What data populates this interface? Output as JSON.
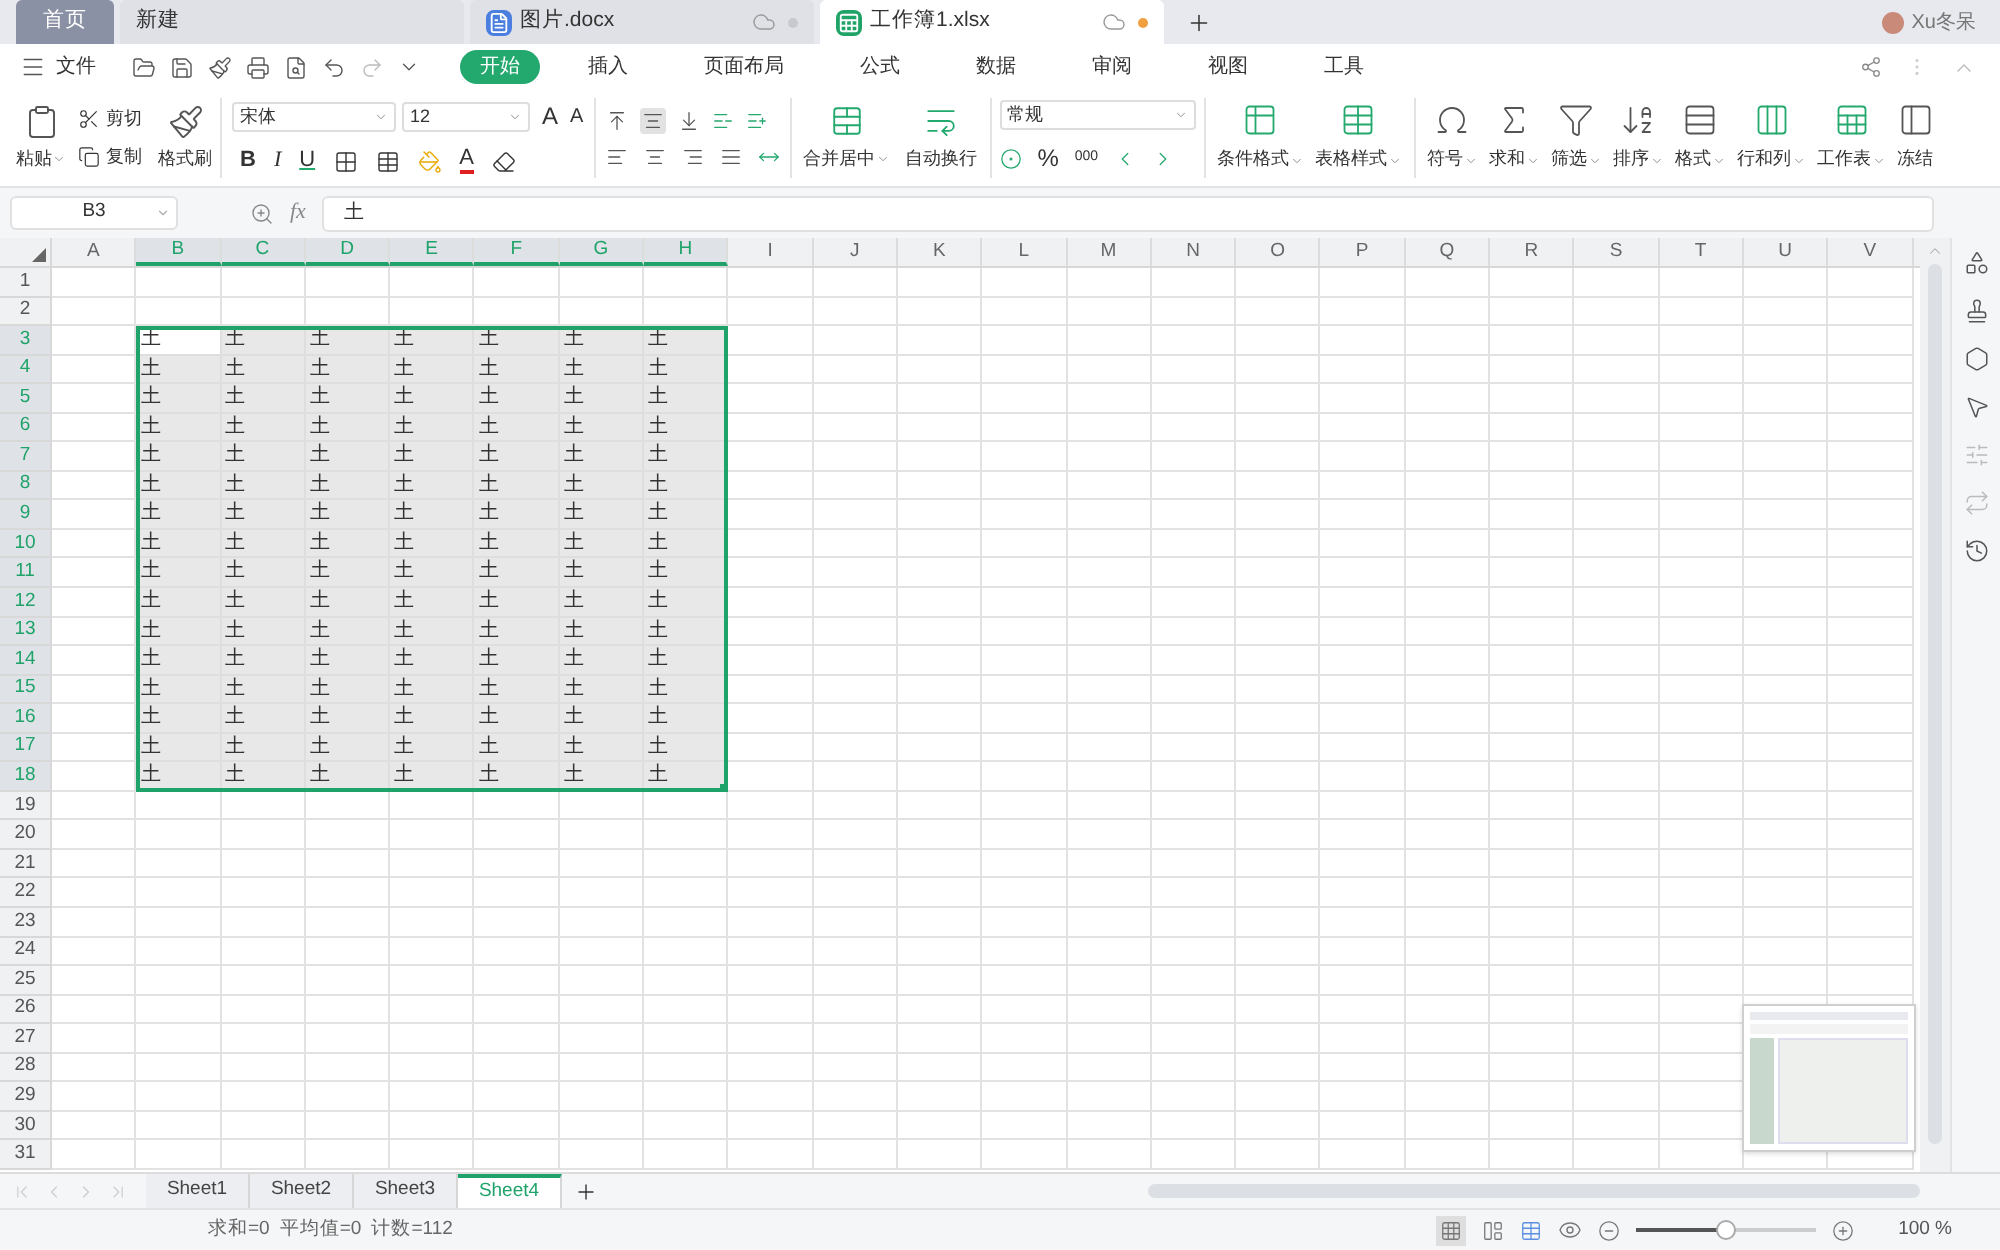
{
  "tabs": [
    {
      "label": "首页",
      "kind": "home",
      "selected": false
    },
    {
      "label": "新建",
      "kind": "new",
      "selected": false
    },
    {
      "label": "图片.docx",
      "kind": "doc",
      "selected": false,
      "unsaved": false
    },
    {
      "label": "工作簿1.xlsx",
      "kind": "sheet",
      "selected": true,
      "unsaved": true
    }
  ],
  "user": {
    "name": "Xu冬呆"
  },
  "menu": {
    "file": "文件",
    "tabs": [
      {
        "label": "开始",
        "selected": true
      },
      {
        "label": "插入",
        "selected": false
      },
      {
        "label": "页面布局",
        "selected": false
      },
      {
        "label": "公式",
        "selected": false
      },
      {
        "label": "数据",
        "selected": false
      },
      {
        "label": "审阅",
        "selected": false
      },
      {
        "label": "视图",
        "selected": false
      },
      {
        "label": "工具",
        "selected": false
      }
    ]
  },
  "ribbon": {
    "paste": "粘贴",
    "cut": "剪切",
    "copy": "复制",
    "format_painter": "格式刷",
    "font": "宋体",
    "font_size": "12",
    "grow_font": "A",
    "shrink_font": "A",
    "bold": "B",
    "italic": "I",
    "underline": "U",
    "font_color": "A",
    "merge": "合并居中",
    "wrap": "自动换行",
    "number_format": "常规",
    "percent": "%",
    "thousands": "000",
    "big_buttons": [
      {
        "label": "条件格式",
        "kind": "conditional"
      },
      {
        "label": "表格样式",
        "kind": "tablestyle"
      },
      {
        "label": "符号",
        "kind": "symbol"
      },
      {
        "label": "求和",
        "kind": "sum"
      },
      {
        "label": "筛选",
        "kind": "filter"
      },
      {
        "label": "排序",
        "kind": "sort"
      },
      {
        "label": "格式",
        "kind": "format"
      },
      {
        "label": "行和列",
        "kind": "rowcol"
      },
      {
        "label": "工作表",
        "kind": "worksheet"
      },
      {
        "label": "冻结",
        "kind": "freeze"
      }
    ]
  },
  "formula_bar": {
    "name_box": "B3",
    "fx": "fx",
    "value": "土"
  },
  "columns": [
    {
      "label": "A",
      "selected": false
    },
    {
      "label": "B",
      "selected": true
    },
    {
      "label": "C",
      "selected": true
    },
    {
      "label": "D",
      "selected": true
    },
    {
      "label": "E",
      "selected": true
    },
    {
      "label": "F",
      "selected": true
    },
    {
      "label": "G",
      "selected": true
    },
    {
      "label": "H",
      "selected": true
    },
    {
      "label": "I",
      "selected": false
    },
    {
      "label": "J",
      "selected": false
    },
    {
      "label": "K",
      "selected": false
    },
    {
      "label": "L",
      "selected": false
    },
    {
      "label": "M",
      "selected": false
    },
    {
      "label": "N",
      "selected": false
    },
    {
      "label": "O",
      "selected": false
    },
    {
      "label": "P",
      "selected": false
    },
    {
      "label": "Q",
      "selected": false
    },
    {
      "label": "R",
      "selected": false
    },
    {
      "label": "S",
      "selected": false
    },
    {
      "label": "T",
      "selected": false
    },
    {
      "label": "U",
      "selected": false
    },
    {
      "label": "V",
      "selected": false
    }
  ],
  "rows": [
    {
      "label": "1",
      "selected": false
    },
    {
      "label": "2",
      "selected": false
    },
    {
      "label": "3",
      "selected": true,
      "cells": [
        null,
        {
          "text": "土",
          "active": true
        },
        {
          "text": "土",
          "active": false
        },
        {
          "text": "土",
          "active": false
        },
        {
          "text": "土",
          "active": false
        },
        {
          "text": "土",
          "active": false
        },
        {
          "text": "土",
          "active": false
        },
        {
          "text": "土",
          "active": false
        }
      ]
    },
    {
      "label": "4",
      "selected": true,
      "cells": [
        null,
        {
          "text": "土",
          "active": false
        },
        {
          "text": "土",
          "active": false
        },
        {
          "text": "土",
          "active": false
        },
        {
          "text": "土",
          "active": false
        },
        {
          "text": "土",
          "active": false
        },
        {
          "text": "土",
          "active": false
        },
        {
          "text": "土",
          "active": false
        }
      ]
    },
    {
      "label": "5",
      "selected": true,
      "cells": [
        null,
        {
          "text": "土",
          "active": false
        },
        {
          "text": "土",
          "active": false
        },
        {
          "text": "土",
          "active": false
        },
        {
          "text": "土",
          "active": false
        },
        {
          "text": "土",
          "active": false
        },
        {
          "text": "土",
          "active": false
        },
        {
          "text": "土",
          "active": false
        }
      ]
    },
    {
      "label": "6",
      "selected": true,
      "cells": [
        null,
        {
          "text": "土",
          "active": false
        },
        {
          "text": "土",
          "active": false
        },
        {
          "text": "土",
          "active": false
        },
        {
          "text": "土",
          "active": false
        },
        {
          "text": "土",
          "active": false
        },
        {
          "text": "土",
          "active": false
        },
        {
          "text": "土",
          "active": false
        }
      ]
    },
    {
      "label": "7",
      "selected": true,
      "cells": [
        null,
        {
          "text": "土",
          "active": false
        },
        {
          "text": "土",
          "active": false
        },
        {
          "text": "土",
          "active": false
        },
        {
          "text": "土",
          "active": false
        },
        {
          "text": "土",
          "active": false
        },
        {
          "text": "土",
          "active": false
        },
        {
          "text": "土",
          "active": false
        }
      ]
    },
    {
      "label": "8",
      "selected": true,
      "cells": [
        null,
        {
          "text": "土",
          "active": false
        },
        {
          "text": "土",
          "active": false
        },
        {
          "text": "土",
          "active": false
        },
        {
          "text": "土",
          "active": false
        },
        {
          "text": "土",
          "active": false
        },
        {
          "text": "土",
          "active": false
        },
        {
          "text": "土",
          "active": false
        }
      ]
    },
    {
      "label": "9",
      "selected": true,
      "cells": [
        null,
        {
          "text": "土",
          "active": false
        },
        {
          "text": "土",
          "active": false
        },
        {
          "text": "土",
          "active": false
        },
        {
          "text": "土",
          "active": false
        },
        {
          "text": "土",
          "active": false
        },
        {
          "text": "土",
          "active": false
        },
        {
          "text": "土",
          "active": false
        }
      ]
    },
    {
      "label": "10",
      "selected": true,
      "cells": [
        null,
        {
          "text": "土",
          "active": false
        },
        {
          "text": "土",
          "active": false
        },
        {
          "text": "土",
          "active": false
        },
        {
          "text": "土",
          "active": false
        },
        {
          "text": "土",
          "active": false
        },
        {
          "text": "土",
          "active": false
        },
        {
          "text": "土",
          "active": false
        }
      ]
    },
    {
      "label": "11",
      "selected": true,
      "cells": [
        null,
        {
          "text": "土",
          "active": false
        },
        {
          "text": "土",
          "active": false
        },
        {
          "text": "土",
          "active": false
        },
        {
          "text": "土",
          "active": false
        },
        {
          "text": "土",
          "active": false
        },
        {
          "text": "土",
          "active": false
        },
        {
          "text": "土",
          "active": false
        }
      ]
    },
    {
      "label": "12",
      "selected": true,
      "cells": [
        null,
        {
          "text": "土",
          "active": false
        },
        {
          "text": "土",
          "active": false
        },
        {
          "text": "土",
          "active": false
        },
        {
          "text": "土",
          "active": false
        },
        {
          "text": "土",
          "active": false
        },
        {
          "text": "土",
          "active": false
        },
        {
          "text": "土",
          "active": false
        }
      ]
    },
    {
      "label": "13",
      "selected": true,
      "cells": [
        null,
        {
          "text": "土",
          "active": false
        },
        {
          "text": "土",
          "active": false
        },
        {
          "text": "土",
          "active": false
        },
        {
          "text": "土",
          "active": false
        },
        {
          "text": "土",
          "active": false
        },
        {
          "text": "土",
          "active": false
        },
        {
          "text": "土",
          "active": false
        }
      ]
    },
    {
      "label": "14",
      "selected": true,
      "cells": [
        null,
        {
          "text": "土",
          "active": false
        },
        {
          "text": "土",
          "active": false
        },
        {
          "text": "土",
          "active": false
        },
        {
          "text": "土",
          "active": false
        },
        {
          "text": "土",
          "active": false
        },
        {
          "text": "土",
          "active": false
        },
        {
          "text": "土",
          "active": false
        }
      ]
    },
    {
      "label": "15",
      "selected": true,
      "cells": [
        null,
        {
          "text": "土",
          "active": false
        },
        {
          "text": "土",
          "active": false
        },
        {
          "text": "土",
          "active": false
        },
        {
          "text": "土",
          "active": false
        },
        {
          "text": "土",
          "active": false
        },
        {
          "text": "土",
          "active": false
        },
        {
          "text": "土",
          "active": false
        }
      ]
    },
    {
      "label": "16",
      "selected": true,
      "cells": [
        null,
        {
          "text": "土",
          "active": false
        },
        {
          "text": "土",
          "active": false
        },
        {
          "text": "土",
          "active": false
        },
        {
          "text": "土",
          "active": false
        },
        {
          "text": "土",
          "active": false
        },
        {
          "text": "土",
          "active": false
        },
        {
          "text": "土",
          "active": false
        }
      ]
    },
    {
      "label": "17",
      "selected": true,
      "cells": [
        null,
        {
          "text": "土",
          "active": false
        },
        {
          "text": "土",
          "active": false
        },
        {
          "text": "土",
          "active": false
        },
        {
          "text": "土",
          "active": false
        },
        {
          "text": "土",
          "active": false
        },
        {
          "text": "土",
          "active": false
        },
        {
          "text": "土",
          "active": false
        }
      ]
    },
    {
      "label": "18",
      "selected": true,
      "cells": [
        null,
        {
          "text": "土",
          "active": false
        },
        {
          "text": "土",
          "active": false
        },
        {
          "text": "土",
          "active": false
        },
        {
          "text": "土",
          "active": false
        },
        {
          "text": "土",
          "active": false
        },
        {
          "text": "土",
          "active": false
        },
        {
          "text": "土",
          "active": false
        }
      ]
    },
    {
      "label": "19",
      "selected": false
    },
    {
      "label": "20",
      "selected": false
    },
    {
      "label": "21",
      "selected": false
    },
    {
      "label": "22",
      "selected": false
    },
    {
      "label": "23",
      "selected": false
    },
    {
      "label": "24",
      "selected": false
    },
    {
      "label": "25",
      "selected": false
    },
    {
      "label": "26",
      "selected": false
    },
    {
      "label": "27",
      "selected": false
    },
    {
      "label": "28",
      "selected": false
    },
    {
      "label": "29",
      "selected": false
    },
    {
      "label": "30",
      "selected": false
    },
    {
      "label": "31",
      "selected": false
    }
  ],
  "sheets": [
    {
      "label": "Sheet1",
      "selected": false
    },
    {
      "label": "Sheet2",
      "selected": false
    },
    {
      "label": "Sheet3",
      "selected": false
    },
    {
      "label": "Sheet4",
      "selected": true
    }
  ],
  "status_bar": {
    "stats": [
      "求和=0",
      "平均值=0",
      "计数=112"
    ],
    "zoom": {
      "level": 0.5,
      "reading": "100 %"
    }
  }
}
